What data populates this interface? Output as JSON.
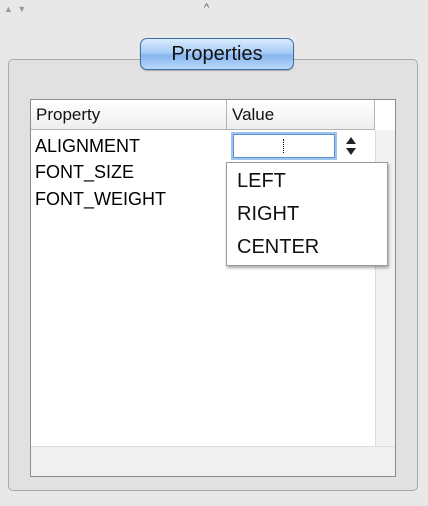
{
  "window": {
    "corner_arrows": "▲ ▼",
    "top_caret": "^"
  },
  "panel": {
    "tab_label": "Properties"
  },
  "table": {
    "headers": [
      "Property",
      "Value"
    ],
    "rows": [
      {
        "property": "ALIGNMENT"
      },
      {
        "property": "FONT_SIZE"
      },
      {
        "property": "FONT_WEIGHT"
      }
    ],
    "editor": {
      "current_value": ""
    }
  },
  "dropdown": {
    "options": [
      "LEFT",
      "RIGHT",
      "CENTER"
    ]
  },
  "icons": {
    "stepper": "up-down-arrows-icon",
    "window_resize": "triangle-arrows-icon"
  },
  "colors": {
    "tab_accent": "#86b6ee",
    "focus_ring": "#9ec3ee"
  }
}
